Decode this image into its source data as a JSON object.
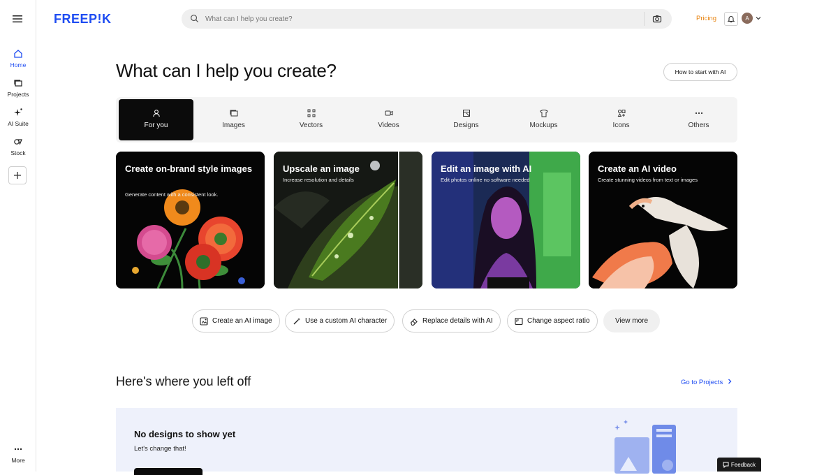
{
  "brand": {
    "logo": "FREEP!K",
    "color": "#1f4df2"
  },
  "sidebar": {
    "items": [
      {
        "label": "Home",
        "icon": "home-icon"
      },
      {
        "label": "Projects",
        "icon": "projects-icon"
      },
      {
        "label": "AI Suite",
        "icon": "sparkle-icon"
      },
      {
        "label": "Stock",
        "icon": "stock-icon"
      }
    ],
    "more_label": "More"
  },
  "search": {
    "placeholder": "What can I help you create?"
  },
  "header": {
    "pricing": "Pricing",
    "avatar_initial": "A"
  },
  "hero": {
    "title": "What can I help you create?",
    "how_to": "How to start with AI"
  },
  "tabs": [
    {
      "label": "For you",
      "icon": "user-icon"
    },
    {
      "label": "Images",
      "icon": "images-icon"
    },
    {
      "label": "Vectors",
      "icon": "vectors-icon"
    },
    {
      "label": "Videos",
      "icon": "video-icon"
    },
    {
      "label": "Designs",
      "icon": "designs-icon"
    },
    {
      "label": "Mockups",
      "icon": "mockup-icon"
    },
    {
      "label": "Icons",
      "icon": "icons-icon"
    },
    {
      "label": "Others",
      "icon": "ellipsis-icon"
    }
  ],
  "cards": [
    {
      "title": "Create on-brand style images",
      "subtitle": "Generate content with a consistent look."
    },
    {
      "title": "Upscale an image",
      "subtitle": "Increase resolution and details"
    },
    {
      "title": "Edit an image with AI",
      "subtitle": "Edit photos online no software needed"
    },
    {
      "title": "Create an AI video",
      "subtitle": "Create stunning videos from text or images"
    }
  ],
  "quick_actions": [
    {
      "label": "Create an AI image",
      "icon": "ai-image-icon"
    },
    {
      "label": "Use a custom AI character",
      "icon": "magic-wand-icon"
    },
    {
      "label": "Replace details with AI",
      "icon": "eraser-icon"
    },
    {
      "label": "Change aspect ratio",
      "icon": "aspect-ratio-icon"
    },
    {
      "label": "View more"
    }
  ],
  "recent": {
    "title": "Here's where you left off",
    "go_projects": "Go to Projects",
    "empty_title": "No designs to show yet",
    "empty_subtitle": "Let's change that!"
  },
  "feedback": "Feedback",
  "colors": {
    "accent": "#1f4df2",
    "pricing": "#e88411",
    "active_tab": "#0b0b0b"
  }
}
